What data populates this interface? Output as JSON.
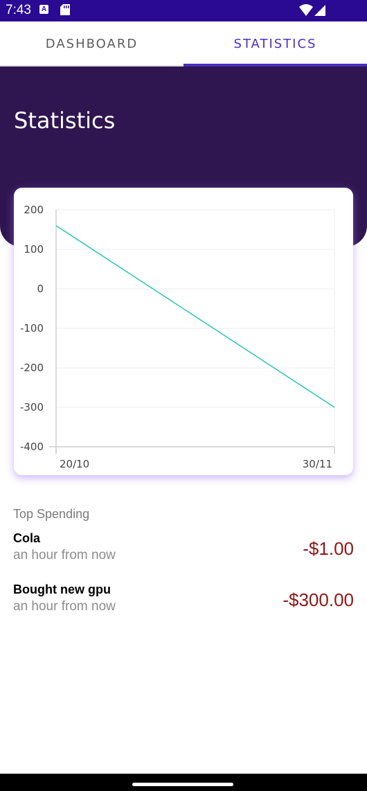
{
  "status_bar": {
    "time": "7:43",
    "icons": [
      "a-notification-icon",
      "sd-card-icon",
      "wifi-icon",
      "signal-icon"
    ]
  },
  "tabs": [
    {
      "label": "DASHBOARD",
      "selected": false
    },
    {
      "label": "STATISTICS",
      "selected": true
    }
  ],
  "header": {
    "title": "Statistics"
  },
  "chart_data": {
    "type": "line",
    "x": [
      "20/10",
      "30/11"
    ],
    "series": [
      {
        "values": [
          160,
          -300
        ],
        "color": "#26c6b4"
      }
    ],
    "y_ticks": [
      200,
      100,
      0,
      -100,
      -200,
      -300,
      -400
    ],
    "x_ticks": [
      "20/10",
      "30/11"
    ],
    "ylim": [
      -400,
      200
    ],
    "grid": true
  },
  "top_spending": {
    "heading": "Top Spending",
    "items": [
      {
        "title": "Cola",
        "time": "an hour from now",
        "amount": "-$1.00"
      },
      {
        "title": "Bought new gpu",
        "time": "an hour from now",
        "amount": "-$300.00"
      }
    ]
  },
  "colors": {
    "status_bar": "#2a0a92",
    "header": "#2f1650",
    "accent": "#4a2fbd",
    "amount": "#8e1717",
    "line": "#26c6b4"
  }
}
